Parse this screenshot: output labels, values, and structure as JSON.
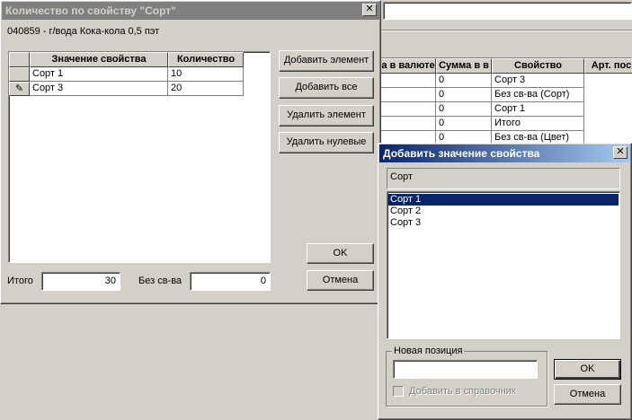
{
  "background_window": {
    "grid_headers": [
      "а в валюте",
      "Сумма в в",
      "Свойство",
      "Арт. пос"
    ],
    "rows": [
      {
        "sum": "0",
        "property": "Сорт 3"
      },
      {
        "sum": "0",
        "property": "Без св-ва (Сорт)"
      },
      {
        "sum": "0",
        "property": "Сорт 1"
      },
      {
        "sum": "0",
        "property": "Итого"
      },
      {
        "sum": "0",
        "property": "Без св-ва (Цвет)"
      }
    ]
  },
  "qty_dialog": {
    "title": "Количество по свойству \"Сорт\"",
    "product": "040859 - г/вода Кока-кола  0,5 пэт",
    "grid_headers": {
      "value": "Значение свойства",
      "quantity": "Количество"
    },
    "rows": [
      {
        "value": "Сорт 1",
        "quantity": "10"
      },
      {
        "value": "Сорт 3",
        "quantity": "20"
      }
    ],
    "buttons": {
      "add_element": "Добавить элемент",
      "add_all": "Добавить все",
      "delete_element": "Удалить элемент",
      "delete_zero": "Удалить нулевые",
      "ok": "OK",
      "cancel": "Отмена"
    },
    "total_label": "Итого",
    "total_value": "30",
    "no_prop_label": "Без св-ва",
    "no_prop_value": "0"
  },
  "add_dialog": {
    "title": "Добавить значение свойства",
    "property_name": "Сорт",
    "options": [
      "Сорт 1",
      "Сорт 2",
      "Сорт 3"
    ],
    "selected_index": 0,
    "new_position_label": "Новая позиция",
    "new_position_value": "",
    "add_to_catalog_label": "Добавить в справочник",
    "ok": "OK",
    "cancel": "Отмена"
  },
  "colors": {
    "selection": "#0a246a",
    "face": "#d4d0c8"
  }
}
